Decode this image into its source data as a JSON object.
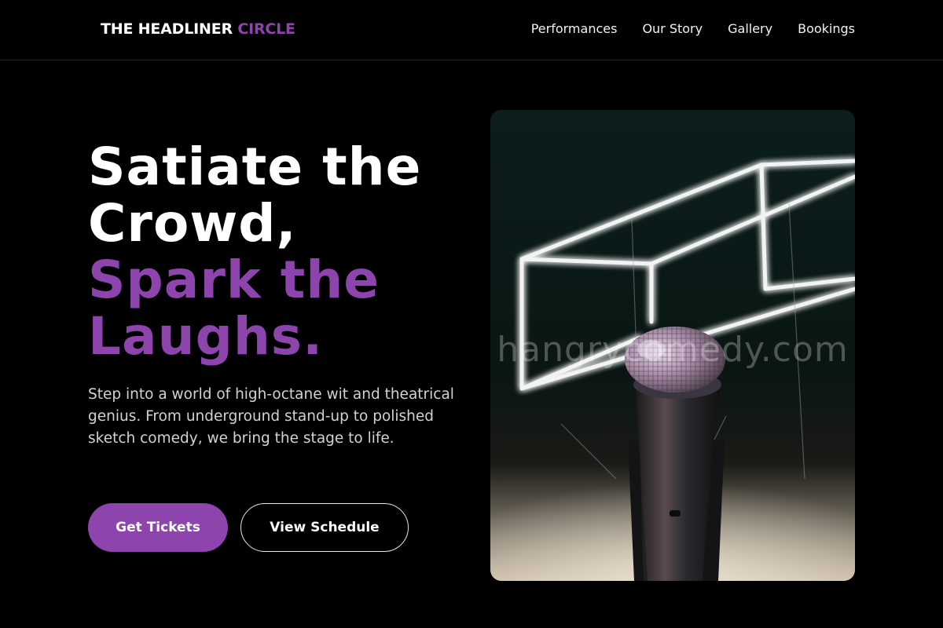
{
  "brand": {
    "name_primary": "THE HEADLINER",
    "name_accent": "CIRCLE",
    "accent_color": "#8e44ad"
  },
  "nav": {
    "items": [
      {
        "label": "Performances"
      },
      {
        "label": "Our Story"
      },
      {
        "label": "Gallery"
      },
      {
        "label": "Bookings"
      }
    ]
  },
  "hero": {
    "headline_white_1": "Satiate the",
    "headline_white_2": "Crowd,",
    "headline_accent_1": "Spark the",
    "headline_accent_2": "Laughs.",
    "description": "Step into a world of high-octane wit and theatrical genius. From underground stand-up to polished sketch comedy, we bring the stage to life.",
    "primary_cta": "Get Tickets",
    "secondary_cta": "View Schedule",
    "image_watermark": "hangrycomedy.com",
    "image_subject": "microphone-on-stage-neon-cube"
  }
}
